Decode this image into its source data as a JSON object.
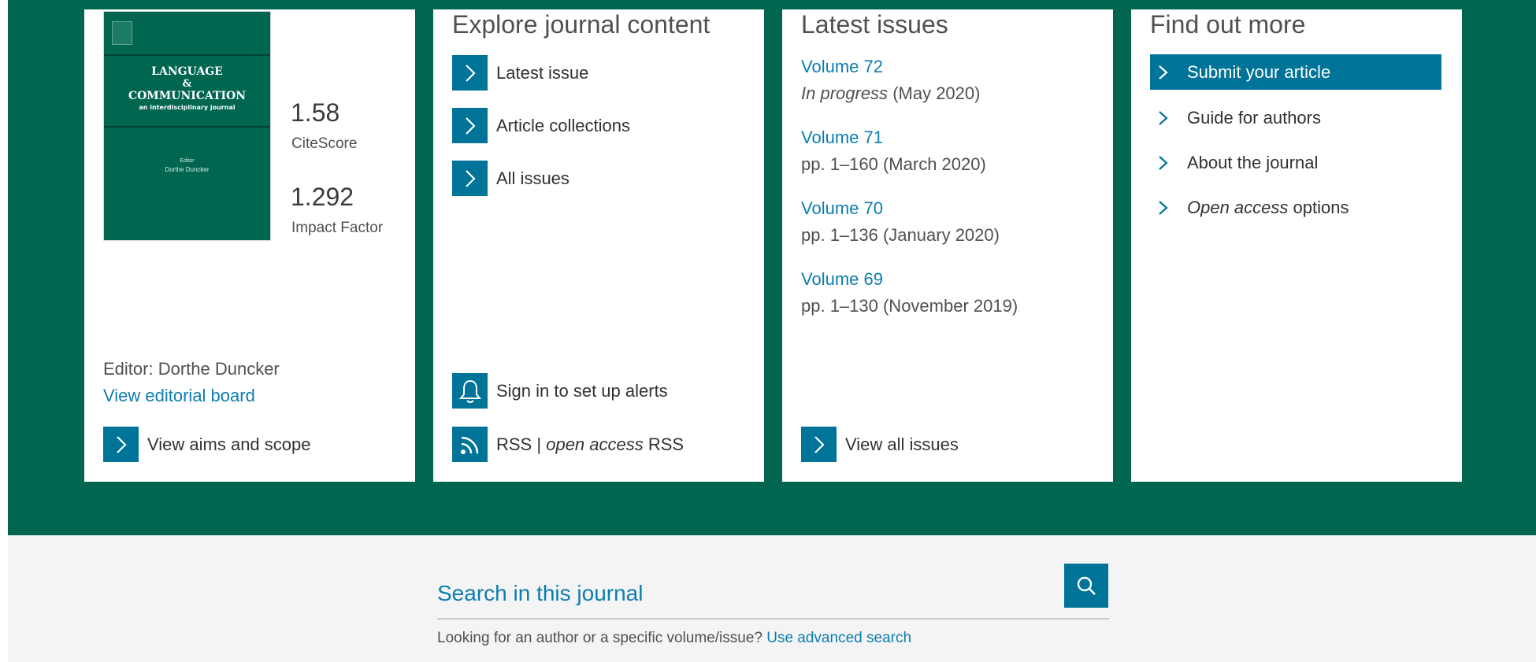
{
  "journal": {
    "cover": {
      "title_line1": "LANGUAGE",
      "title_line2": "&",
      "title_line3": "COMMUNICATION",
      "subtitle": "an interdisciplinary journal",
      "editor_caption": "Editor",
      "editor_name": "Dorthe Duncker"
    },
    "metrics": [
      {
        "value": "1.58",
        "label": "CiteScore"
      },
      {
        "value": "1.292",
        "label": "Impact Factor"
      }
    ],
    "editor_text": "Editor: Dorthe Duncker",
    "editorial_board_link": "View editorial board",
    "aims_scope_label": "View aims and scope"
  },
  "explore": {
    "title": "Explore journal content",
    "items": [
      {
        "label": "Latest issue"
      },
      {
        "label": "Article collections"
      },
      {
        "label": "All issues"
      }
    ],
    "alerts_label": "Sign in to set up alerts",
    "rss": {
      "label_a": "RSS",
      "separator": "|",
      "label_b_italic": "open access",
      "label_c": "RSS"
    }
  },
  "latest_issues": {
    "title": "Latest issues",
    "issues": [
      {
        "volume": "Volume 72",
        "desc_italic": "In progress",
        "desc": "(May 2020)"
      },
      {
        "volume": "Volume 71",
        "desc_italic": "",
        "desc": "pp. 1–160 (March 2020)"
      },
      {
        "volume": "Volume 70",
        "desc_italic": "",
        "desc": "pp. 1–136 (January 2020)"
      },
      {
        "volume": "Volume 69",
        "desc_italic": "",
        "desc": "pp. 1–130 (November 2019)"
      }
    ],
    "view_all_label": "View all issues"
  },
  "find_out_more": {
    "title": "Find out more",
    "items": [
      {
        "label": "Submit your article",
        "italic_prefix": ""
      },
      {
        "label": "Guide for authors",
        "italic_prefix": ""
      },
      {
        "label": "About the journal",
        "italic_prefix": ""
      },
      {
        "label": "options",
        "italic_prefix": "Open access"
      }
    ]
  },
  "search": {
    "placeholder": "Search in this journal",
    "hint": "Looking for an author or a specific volume/issue?",
    "advanced_link": "Use advanced search"
  },
  "colors": {
    "brand_green": "#006650",
    "accent_blue": "#007398",
    "link_blue": "#0c7db0"
  }
}
